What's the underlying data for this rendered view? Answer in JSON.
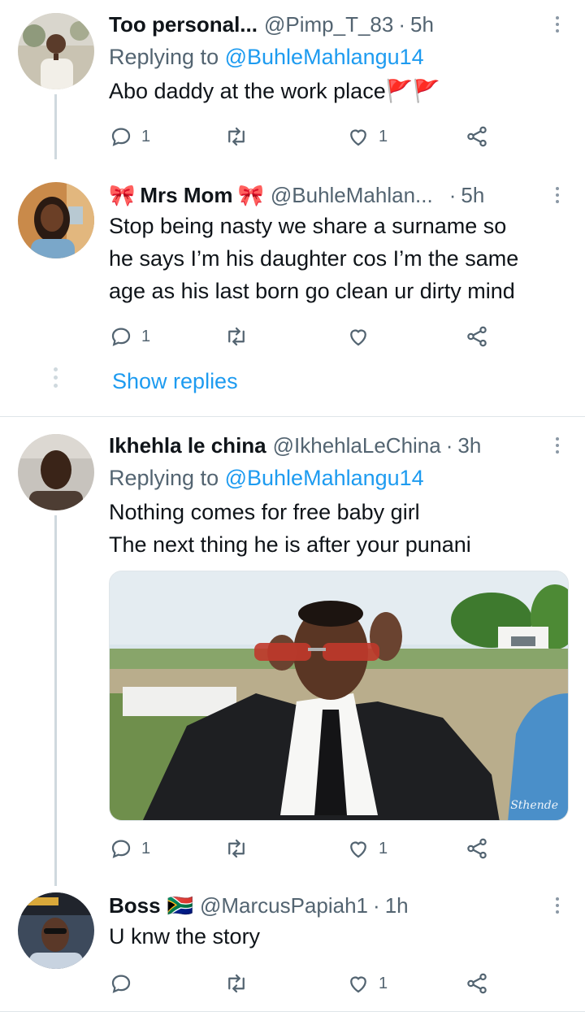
{
  "tweets": [
    {
      "name": "Too personal...",
      "handle": "@Pimp_T_83",
      "separator": "·",
      "time": "5h",
      "replying_prefix": "Replying to",
      "replying_to": "@BuhleMahlangu14",
      "text_lines": [
        "Abo daddy at the work place"
      ],
      "flags": "🚩🚩",
      "reply_count": "1",
      "retweet_count": "",
      "like_count": "1"
    },
    {
      "name_prefix_emoji": "🎀",
      "name": "Mrs Mom",
      "name_suffix_emoji": "🎀",
      "handle": "@BuhleMahlan...",
      "separator": "·",
      "time": "5h",
      "text_lines": [
        "Stop being nasty we share a surname so",
        "he says I’m his daughter cos I’m the same",
        "age as his last born go clean ur dirty mind"
      ],
      "reply_count": "1",
      "retweet_count": "",
      "like_count": ""
    },
    {
      "name": "Ikhehla le china",
      "handle": "@IkhehlaLeChina",
      "separator": "·",
      "time": "3h",
      "replying_prefix": "Replying to",
      "replying_to": "@BuhleMahlangu14",
      "text_lines": [
        "Nothing comes for free baby girl",
        "The next thing he is after your punani"
      ],
      "media_watermark": "Sthende",
      "reply_count": "1",
      "retweet_count": "",
      "like_count": "1"
    },
    {
      "name": "Boss",
      "name_suffix_emoji": "🇿🇦",
      "handle": "@MarcusPapiah1",
      "separator": "·",
      "time": "1h",
      "text_lines": [
        "U knw the story"
      ],
      "reply_count": "",
      "retweet_count": "",
      "like_count": "1"
    }
  ],
  "show_replies_label": "Show replies",
  "icons": {
    "reply": "reply-icon",
    "retweet": "retweet-icon",
    "like": "heart-icon",
    "share": "share-icon",
    "more": "more-vertical-icon"
  },
  "colors": {
    "link": "#1d9bf0",
    "secondary_text": "#536471",
    "thread_line": "#cfd9de"
  }
}
